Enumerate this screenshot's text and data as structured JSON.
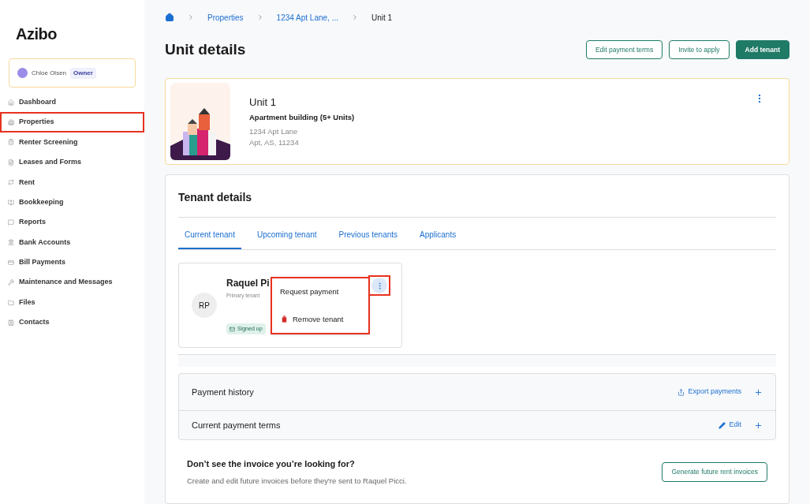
{
  "sidebar": {
    "logo": "Azibo",
    "user": {
      "name": "Chloe Olsen",
      "role": "Owner"
    },
    "items": [
      {
        "label": "Dashboard",
        "highlighted": false
      },
      {
        "label": "Properties",
        "highlighted": true
      },
      {
        "label": "Renter Screening",
        "highlighted": false
      },
      {
        "label": "Leases and Forms",
        "highlighted": false
      },
      {
        "label": "Rent",
        "highlighted": false
      },
      {
        "label": "Bookkeeping",
        "highlighted": false
      },
      {
        "label": "Reports",
        "highlighted": false
      },
      {
        "label": "Bank Accounts",
        "highlighted": false
      },
      {
        "label": "Bill Payments",
        "highlighted": false
      },
      {
        "label": "Maintenance and Messages",
        "highlighted": false
      },
      {
        "label": "Files",
        "highlighted": false
      },
      {
        "label": "Contacts",
        "highlighted": false
      }
    ]
  },
  "breadcrumb": [
    "Properties",
    "1234 Apt Lane, ...",
    "Unit 1"
  ],
  "title": "Unit details",
  "actions": [
    {
      "label": "Edit payment terms",
      "kind": "outline"
    },
    {
      "label": "Invite to apply",
      "kind": "outline"
    },
    {
      "label": "Add tenant",
      "kind": "primary"
    }
  ],
  "unit": {
    "name": "Unit 1",
    "type": "Apartment building (5+ Units)",
    "address_1": "1234 Apt Lane",
    "address_2": "Apt, AS, 11234"
  },
  "tenant_details": {
    "title": "Tenant details",
    "tabs": [
      {
        "label": "Current tenant",
        "selected": true
      },
      {
        "label": "Upcoming tenant",
        "selected": false
      },
      {
        "label": "Previous tenants",
        "selected": false
      },
      {
        "label": "Applicants",
        "selected": false
      }
    ],
    "tenant": {
      "initials": "RP",
      "name": "Raquel Pi",
      "role": "Primary tenant",
      "status": "Signed up",
      "menu_highlighted": true
    },
    "menu": [
      {
        "label": "Request payment",
        "kind": "plain"
      },
      {
        "label": "Remove tenant",
        "kind": "danger"
      }
    ],
    "sections": [
      {
        "title": "Payment history",
        "action": "Export payments",
        "kind": "export"
      },
      {
        "title": "Current payment terms",
        "action": "Edit",
        "kind": "edit"
      }
    ],
    "invoice": {
      "title": "Don’t see the invoice you’re looking for?",
      "text": "Create and edit future invoices before they're sent to Raquel Picci.",
      "button": "Generate future rent invoices"
    }
  }
}
